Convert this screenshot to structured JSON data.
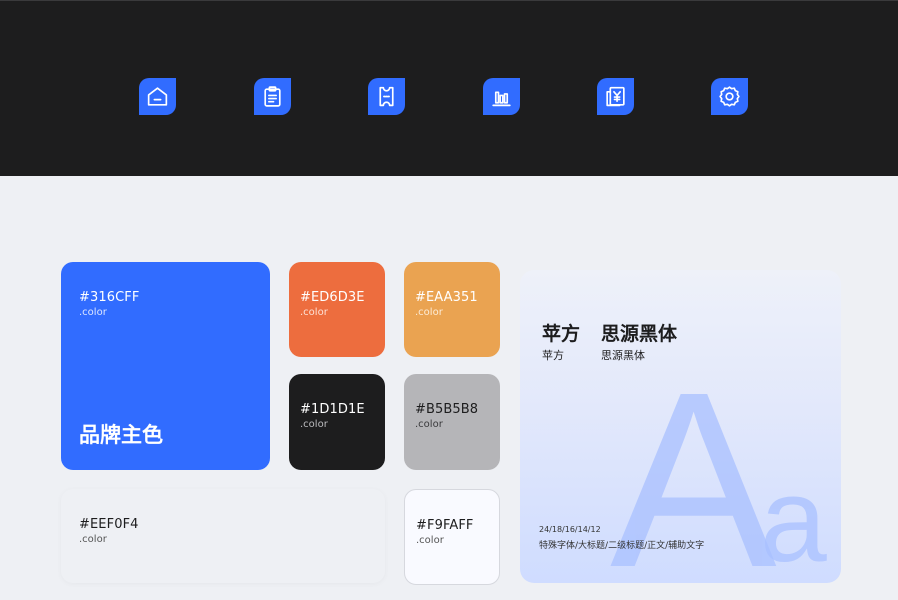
{
  "nav_icons": [
    {
      "name": "home-icon"
    },
    {
      "name": "clipboard-icon"
    },
    {
      "name": "ticket-icon"
    },
    {
      "name": "bar-chart-icon"
    },
    {
      "name": "invoice-yuan-icon"
    },
    {
      "name": "settings-gear-icon"
    }
  ],
  "colors": {
    "brand": {
      "hex": "#316CFF",
      "sub": ".color",
      "title": "品牌主色"
    },
    "orange": {
      "hex": "#ED6D3E",
      "sub": ".color"
    },
    "amber": {
      "hex": "#EAA351",
      "sub": ".color"
    },
    "dark": {
      "hex": "#1D1D1E",
      "sub": ".color"
    },
    "gray": {
      "hex": "#B5B5B8",
      "sub": ".color"
    },
    "bg": {
      "hex": "#EEF0F4",
      "sub": ".color"
    },
    "light": {
      "hex": "#F9FAFF",
      "sub": ".color"
    }
  },
  "fonts": {
    "font1": "苹方",
    "font1_sub": "苹方",
    "font2": "思源黑体",
    "font2_sub": "思源黑体",
    "sizes": "24/18/16/14/12",
    "usage": "特殊字体/大标题/二级标题/正文/辅助文字",
    "big_a": "A",
    "big_aa": "a"
  }
}
